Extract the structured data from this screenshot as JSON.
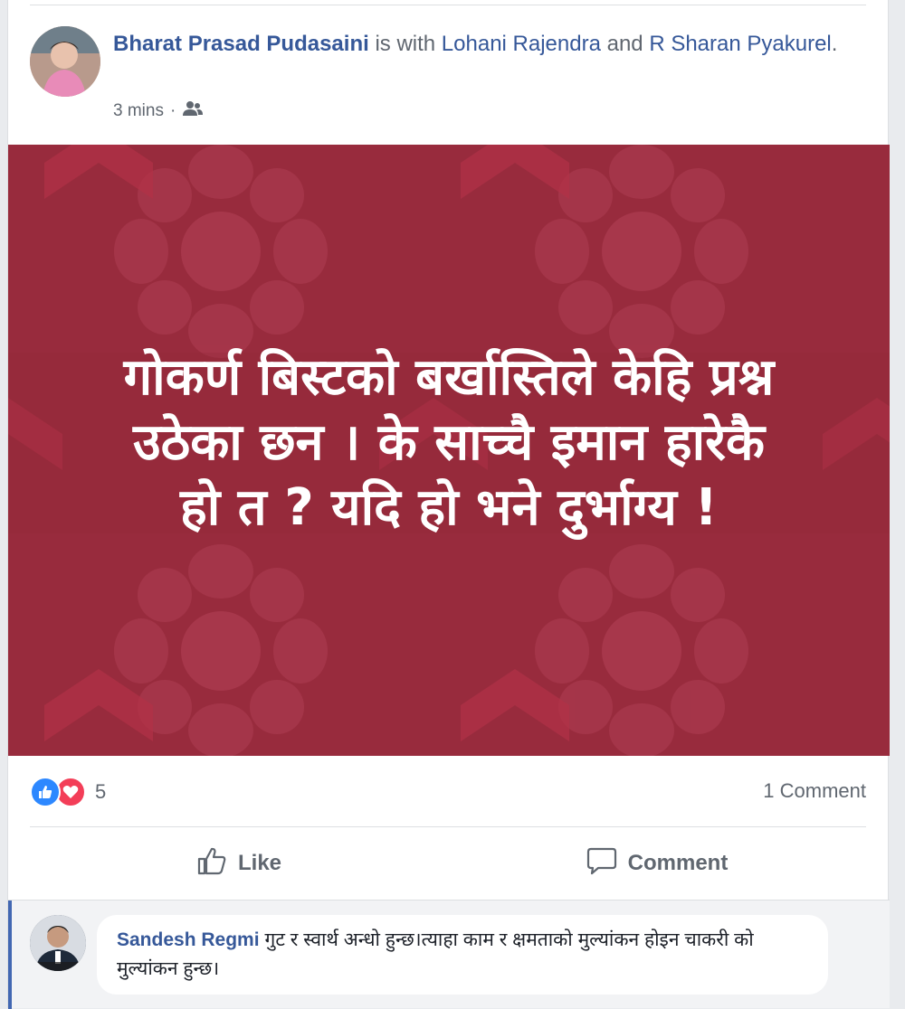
{
  "post": {
    "author": "Bharat Prasad Pudasaini",
    "with_text": " is with ",
    "tagged_1": "Lohani Rajendra",
    "and_text": " and ",
    "tagged_2": "R Sharan Pyakurel",
    "period": ".",
    "time": "3 mins",
    "separator": "·",
    "privacy_icon": "friends-icon",
    "image_text": {
      "line1": "गोकर्ण बिस्टको बर्खास्तिले केहि प्रश्न",
      "line2": "उठेका छन । के साच्चै इमान हारेकै",
      "line3": "हो त ? यदि हो भने दुर्भाग्य !"
    },
    "image_bg_color": "#982b3d"
  },
  "stats": {
    "reaction_count": "5",
    "comment_count": "1 Comment",
    "reaction_icons": [
      "like-reaction-icon",
      "love-reaction-icon"
    ]
  },
  "actions": {
    "like_label": "Like",
    "comment_label": "Comment"
  },
  "comment": {
    "author": "Sandesh Regmi",
    "text": "गुट र स्वार्थ अन्धो हुन्छ।त्याहा काम र क्षमताको मुल्यांकन होइन चाकरी को मुल्यांकन हुन्छ।"
  },
  "colors": {
    "link": "#365899",
    "like_blue": "#2d88ff",
    "love_red": "#f33e58",
    "muted": "#606770"
  }
}
